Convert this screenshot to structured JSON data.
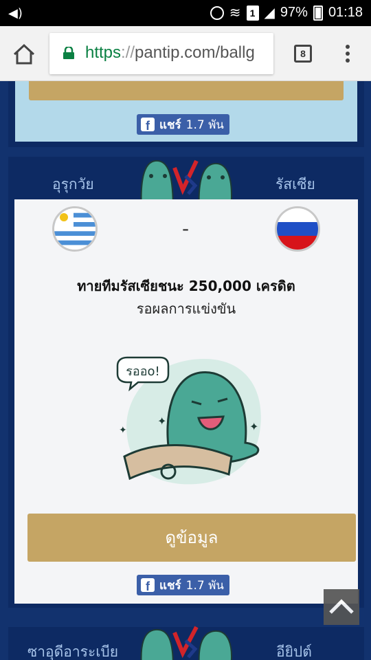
{
  "status_bar": {
    "battery": "97%",
    "time": "01:18",
    "sim": "1"
  },
  "browser": {
    "url_scheme": "https",
    "url_sep": "://",
    "url_rest": "pantip.com/ballg",
    "tab_count": "8"
  },
  "card1": {
    "share_label": "แชร์",
    "share_count": "1.7 พัน"
  },
  "match": {
    "home_team": "อุรุกวัย",
    "away_team": "รัสเซีย",
    "score": "-",
    "bet_title": "ทายทีมรัสเซียชนะ 250,000 เครดิต",
    "bet_status": "รอผลการแข่งขัน",
    "sticker_text": "รออo!",
    "info_button": "ดูข้อมูล",
    "share_label": "แชร์",
    "share_count": "1.7 พัน"
  },
  "next_match": {
    "home_team": "ซาอุดีอาระเบีย",
    "away_team": "อียิปต์"
  },
  "colors": {
    "page_bg": "#12326e",
    "card_bg": "#0d2a63",
    "gold_button": "#c5a564",
    "facebook_blue": "#3b5fa8",
    "mascot_teal": "#4aa895"
  }
}
